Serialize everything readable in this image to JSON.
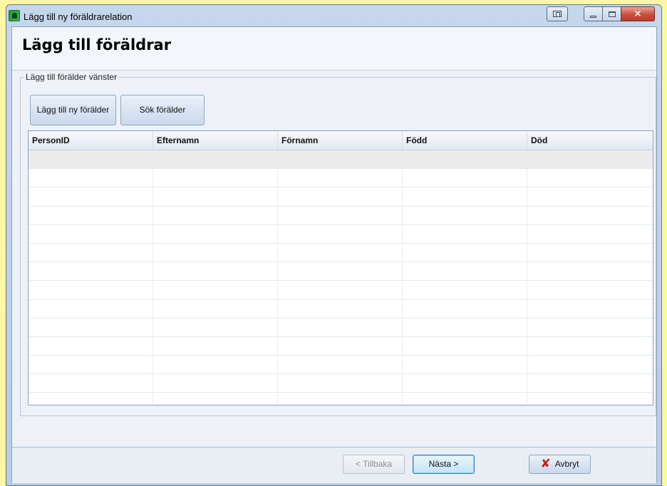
{
  "window": {
    "title": "Lägg till ny föräldrarelation"
  },
  "page": {
    "title": "Lägg till föräldrar"
  },
  "group": {
    "legend": "Lägg till förälder vänster",
    "add_new_label": "Lägg till ny förälder",
    "search_label": "Sök förälder"
  },
  "table": {
    "columns": [
      "PersonID",
      "Efternamn",
      "Förnamn",
      "Född",
      "Död"
    ],
    "rows": [
      [
        "",
        "",
        "",
        "",
        ""
      ],
      [
        "",
        "",
        "",
        "",
        ""
      ],
      [
        "",
        "",
        "",
        "",
        ""
      ],
      [
        "",
        "",
        "",
        "",
        ""
      ],
      [
        "",
        "",
        "",
        "",
        ""
      ],
      [
        "",
        "",
        "",
        "",
        ""
      ],
      [
        "",
        "",
        "",
        "",
        ""
      ],
      [
        "",
        "",
        "",
        "",
        ""
      ],
      [
        "",
        "",
        "",
        "",
        ""
      ],
      [
        "",
        "",
        "",
        "",
        ""
      ],
      [
        "",
        "",
        "",
        "",
        ""
      ],
      [
        "",
        "",
        "",
        "",
        ""
      ],
      [
        "",
        "",
        "",
        "",
        ""
      ],
      [
        "",
        "",
        "",
        "",
        ""
      ]
    ]
  },
  "footer": {
    "back_label": "< Tillbaka",
    "next_label": "Nästa >",
    "cancel_label": "Avbryt"
  },
  "icons": {
    "app": "family-tree-icon",
    "cancel": "red-x-icon"
  },
  "colors": {
    "desktop": "#fdf6a6",
    "window_frame": "#b8cde6",
    "close_button": "#c74f3a",
    "cancel_icon": "#c8201a"
  }
}
